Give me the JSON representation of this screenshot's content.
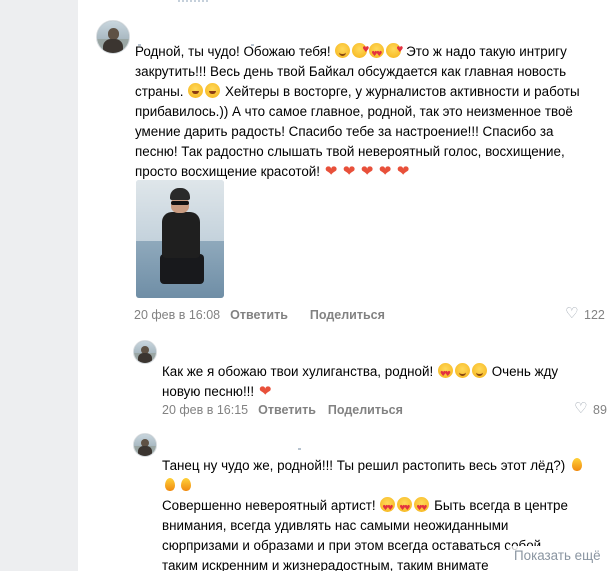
{
  "comment1": {
    "text_lines": [
      "Родной, ты чудо! Обожаю тебя!",
      "Это ж надо такую интригу",
      "закрутить!!! Весь день твой Байкал обсуждается как главная новость",
      "страны.",
      "Хейтеры в восторге, у журналистов активности и работы",
      "прибавилось.)) А что самое главное, родной, так это неизменное твоё",
      "умение дарить радость! Спасибо тебе за настроение!!! Спасибо за",
      "песню! Так радостно слышать твой невероятный голос, восхищение,",
      "просто восхищение красотой!"
    ],
    "date": "20 фев в 16:08",
    "reply": "Ответить",
    "share": "Поделиться",
    "likes": "122"
  },
  "reply1": {
    "text_lines": [
      "Как же я обожаю твои хулиганства, родной!",
      "Очень жду",
      "новую песню!!!"
    ],
    "date": "20 фев в 16:15",
    "reply": "Ответить",
    "share": "Поделиться",
    "likes": "89"
  },
  "reply2": {
    "text_lines": [
      "Танец ну чудо же, родной!!! Ты решил растопить весь этот лёд?)",
      "Совершенно невероятный артист!",
      "Быть всегда в центре",
      "внимания, всегда удивлять нас самыми неожиданными",
      "сюрпризами и образами и при этом всегда оставаться собой,",
      "таким искренним и жизнерадостным, таким внимате"
    ],
    "show_more": "Показать ещё"
  },
  "icons": {
    "heart_like": "heart-outline-icon",
    "emoji": [
      "smile-emoji",
      "love-emoji",
      "heart-emoji",
      "laugh-emoji",
      "flame-emoji"
    ]
  },
  "colors": {
    "meta": "#828282",
    "link": "#8a95a1",
    "background": "#edeef0"
  }
}
